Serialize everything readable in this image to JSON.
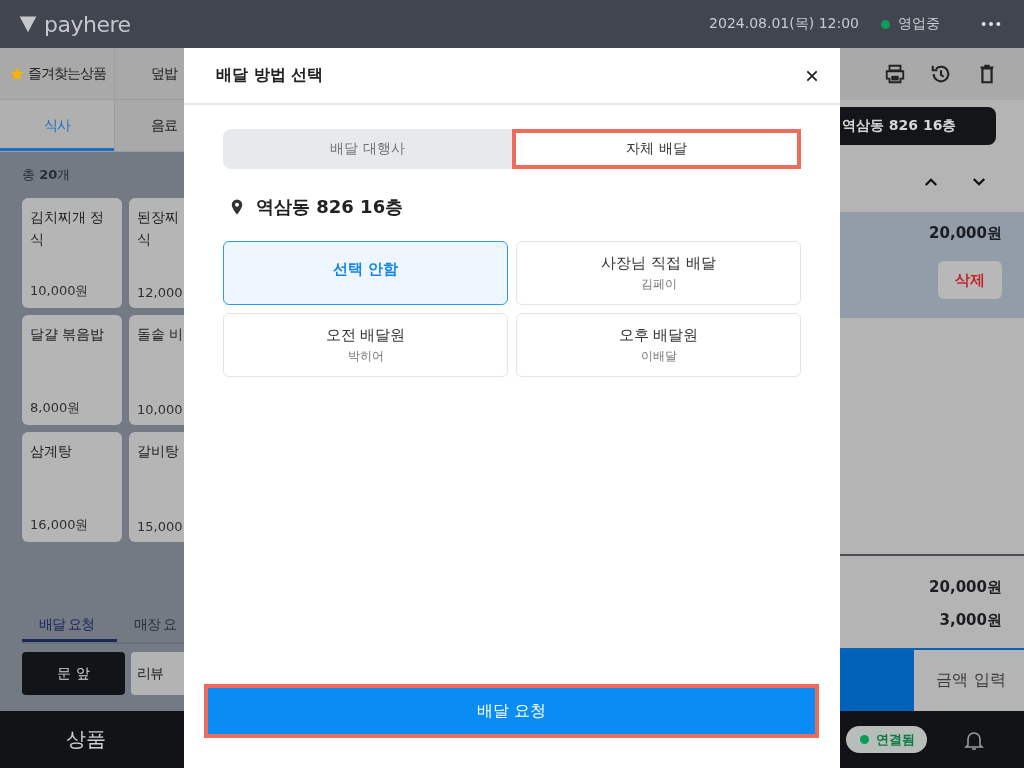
{
  "top_bar": {
    "logo": "payhere",
    "datetime": "2024.08.01(목) 12:00",
    "status": {
      "label": "영업중",
      "color": "#0a9d58"
    }
  },
  "categories": [
    {
      "label": "즐겨찾는상품",
      "favorite": true,
      "selected": false
    },
    {
      "label": "덮밥",
      "favorite": false,
      "selected": false
    },
    {
      "label": "식사",
      "favorite": false,
      "selected": true
    },
    {
      "label": "음료",
      "favorite": false,
      "selected": false
    }
  ],
  "product_count": "총 **20**개",
  "products": [
    {
      "lines": [
        "김치찌개 정",
        "식"
      ],
      "price": "10,000원"
    },
    {
      "lines": [
        "된장찌",
        "식"
      ],
      "price": "12,000"
    },
    {
      "lines": [
        "달걀 볶음밥"
      ],
      "price": "8,000원"
    },
    {
      "lines": [
        "돌솥 비"
      ],
      "price": "10,000"
    },
    {
      "lines": [
        "삼계탕"
      ],
      "price": "16,000원"
    },
    {
      "lines": [
        "갈비탕"
      ],
      "price": "15,000"
    }
  ],
  "request_tabs": [
    {
      "label": "배달 요청",
      "selected": true
    },
    {
      "label": "매장 요",
      "selected": false
    }
  ],
  "request_chips": [
    {
      "label": "문 앞",
      "selected": true
    },
    {
      "label": "리뷰",
      "selected": false
    }
  ],
  "bottom_nav": {
    "label": "상품"
  },
  "order_panel": {
    "address_chip": "역삼동 826 16층",
    "item": {
      "price": "20,000원",
      "delete": "삭제",
      "selected": true
    },
    "totals": [
      "20,000원",
      "3,000원"
    ],
    "amount_button": "금액 입력",
    "connection": {
      "label": "연결됨",
      "color": "#0a9d58"
    }
  },
  "modal": {
    "title": "배달 방법 선택",
    "tabs": [
      {
        "label": "배달 대행사",
        "selected": false,
        "highlighted": false
      },
      {
        "label": "자체 배달",
        "selected": true,
        "highlighted": true
      }
    ],
    "address": "역삼동 826 16층",
    "options": [
      {
        "title": "선택 안함",
        "selected": true
      },
      {
        "title": "사장님 직접 배달",
        "subtitle": "김페이",
        "selected": false
      },
      {
        "title": "오전 배달원",
        "subtitle": "박히어",
        "selected": false
      },
      {
        "title": "오후 배달원",
        "subtitle": "이배달",
        "selected": false
      }
    ],
    "submit": {
      "label": "배달 요청",
      "highlighted": true
    }
  }
}
